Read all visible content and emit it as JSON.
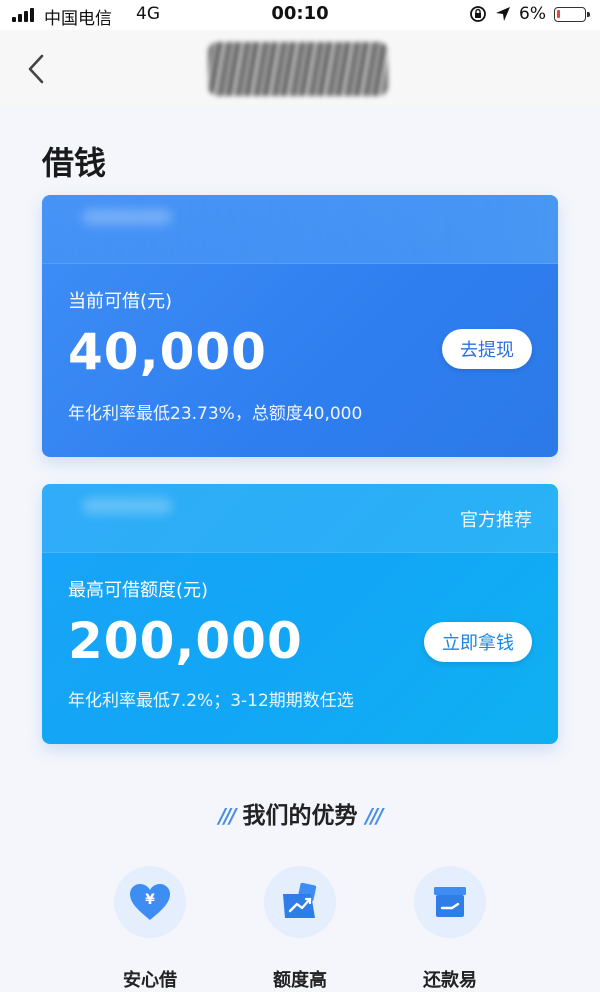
{
  "status_bar": {
    "carrier": "中国电信",
    "network": "4G",
    "time": "00:10",
    "battery": "6%"
  },
  "nav": {
    "back_icon": "chevron-left-icon"
  },
  "page": {
    "title": "借钱"
  },
  "card_current": {
    "label": "当前可借(元)",
    "amount": "40,000",
    "button": "去提现",
    "note": "年化利率最低23.73%，总额度40,000"
  },
  "card_max": {
    "tag": "官方推荐",
    "label": "最高可借额度(元)",
    "amount": "200,000",
    "button": "立即拿钱",
    "note": "年化利率最低7.2%；3-12期期数任选"
  },
  "advantages": {
    "title": "我们的优势",
    "items": [
      {
        "label": "安心借",
        "icon": "heart-yuan-icon"
      },
      {
        "label": "额度高",
        "icon": "trend-up-icon"
      },
      {
        "label": "还款易",
        "icon": "archive-box-icon"
      }
    ]
  },
  "colors": {
    "card1": "#3589f4",
    "card2": "#14a8f5",
    "accent": "#4a90e2"
  }
}
